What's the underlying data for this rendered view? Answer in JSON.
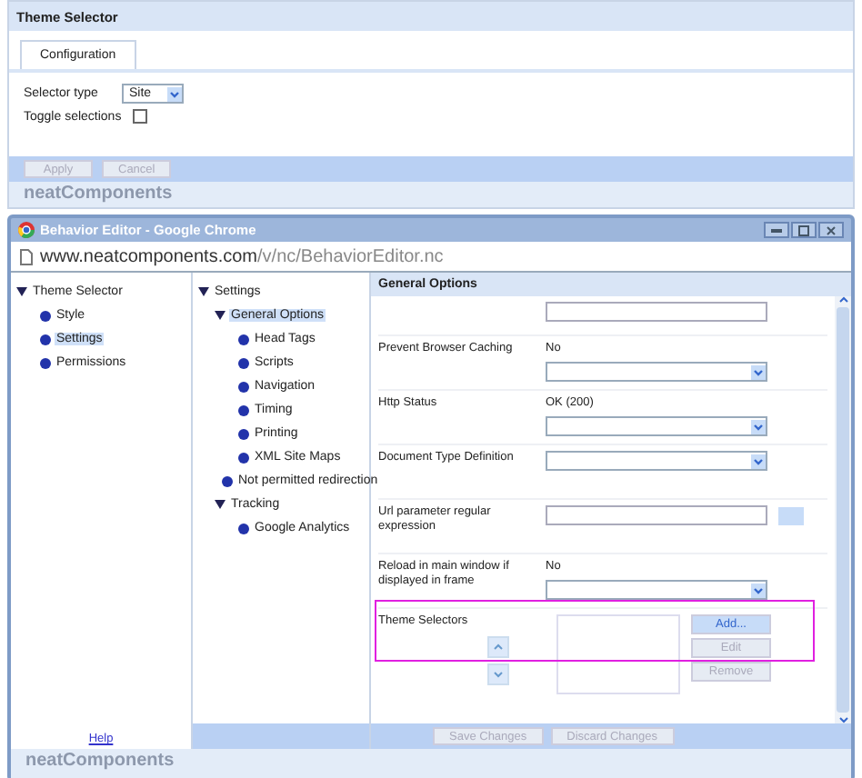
{
  "panel": {
    "title": "Theme Selector",
    "tabs": [
      {
        "label": "Configuration",
        "selected": true
      }
    ],
    "fields": [
      {
        "kind": "select",
        "label": "Selector type",
        "value": "Site"
      },
      {
        "kind": "checkbox",
        "label": "Toggle selections",
        "checked": false
      }
    ],
    "buttons": [
      {
        "label": "Apply",
        "disabled": true
      },
      {
        "label": "Cancel",
        "disabled": true
      }
    ],
    "brand": "neatComponents"
  },
  "browser": {
    "title": "Behavior Editor - Google Chrome",
    "url_host": "www.neatcomponents.com",
    "url_path": "/v/nc/BehaviorEditor.nc",
    "left_tree": [
      {
        "label": "Theme Selector",
        "expanded": true,
        "selected": false,
        "children": [
          {
            "label": "Style",
            "selected": false
          },
          {
            "label": "Settings",
            "selected": true
          },
          {
            "label": "Permissions",
            "selected": false
          }
        ]
      }
    ],
    "help_link": "Help",
    "middle_tree": [
      {
        "label": "Settings",
        "expanded": true,
        "selected": false,
        "children": [
          {
            "label": "General Options",
            "expanded": true,
            "selected": true,
            "children": [
              {
                "label": "Head Tags",
                "selected": false
              },
              {
                "label": "Scripts",
                "selected": false
              },
              {
                "label": "Navigation",
                "selected": false
              },
              {
                "label": "Timing",
                "selected": false
              },
              {
                "label": "Printing",
                "selected": false
              },
              {
                "label": "XML Site Maps",
                "selected": false
              }
            ]
          },
          {
            "label": "Not permitted redirection",
            "selected": false
          },
          {
            "label": "Tracking",
            "expanded": true,
            "selected": false,
            "children": [
              {
                "label": "Google Analytics",
                "selected": false
              }
            ]
          }
        ]
      }
    ],
    "section_title": "General Options",
    "rows": [
      {
        "kind": "input"
      },
      {
        "kind": "select",
        "label": "Prevent Browser Caching",
        "value": "No"
      },
      {
        "kind": "select",
        "label": "Http Status",
        "value": "OK (200)"
      },
      {
        "kind": "select",
        "label": "Document Type Definition"
      },
      {
        "kind": "input-button",
        "label": "Url parameter regular expression"
      },
      {
        "kind": "select",
        "label": "Reload in main window if displayed in frame",
        "value": "No"
      },
      {
        "kind": "list",
        "label": "Theme Selectors",
        "highlighted": true,
        "buttons": [
          {
            "label": "Add...",
            "disabled": false
          },
          {
            "label": "Edit",
            "disabled": true
          },
          {
            "label": "Remove",
            "disabled": true
          }
        ]
      }
    ],
    "footer_buttons": [
      {
        "label": "Save Changes",
        "disabled": true
      },
      {
        "label": "Discard Changes",
        "disabled": true
      }
    ],
    "brand": "neatComponents"
  }
}
